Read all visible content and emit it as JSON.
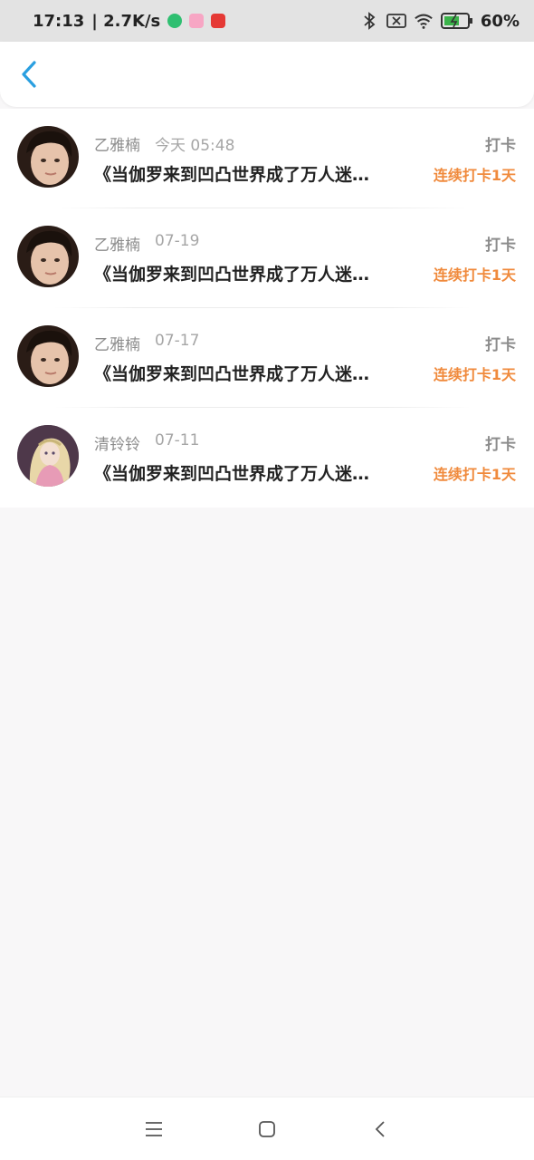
{
  "status_bar": {
    "time": "17:13",
    "speed": "| 2.7K/s",
    "battery": "60%",
    "icons": [
      "shield-app-icon",
      "pink-app-icon",
      "red-app-icon",
      "bluetooth-icon",
      "sim-x-icon",
      "wifi-icon",
      "battery-icon"
    ]
  },
  "header": {
    "back_icon": "chevron-left-icon"
  },
  "items": [
    {
      "name": "乙雅楠",
      "time": "今天 05:48",
      "tag": "打卡",
      "title": "《当伽罗来到凹凸世界成了万人迷…",
      "streak": "连续打卡1天",
      "avatar": "photo-girl"
    },
    {
      "name": "乙雅楠",
      "time": "07-19",
      "tag": "打卡",
      "title": "《当伽罗来到凹凸世界成了万人迷…",
      "streak": "连续打卡1天",
      "avatar": "photo-girl"
    },
    {
      "name": "乙雅楠",
      "time": "07-17",
      "tag": "打卡",
      "title": "《当伽罗来到凹凸世界成了万人迷…",
      "streak": "连续打卡1天",
      "avatar": "photo-girl"
    },
    {
      "name": "清铃铃",
      "time": "07-11",
      "tag": "打卡",
      "title": "《当伽罗来到凹凸世界成了万人迷…",
      "streak": "连续打卡1天",
      "avatar": "anime-character"
    }
  ],
  "colors": {
    "accent_blue": "#2a9fe0",
    "streak_orange": "#f08a3c",
    "background": "#f8f7f8"
  },
  "nav_bar": {
    "icons": [
      "menu-icon",
      "home-icon",
      "back-icon"
    ]
  }
}
